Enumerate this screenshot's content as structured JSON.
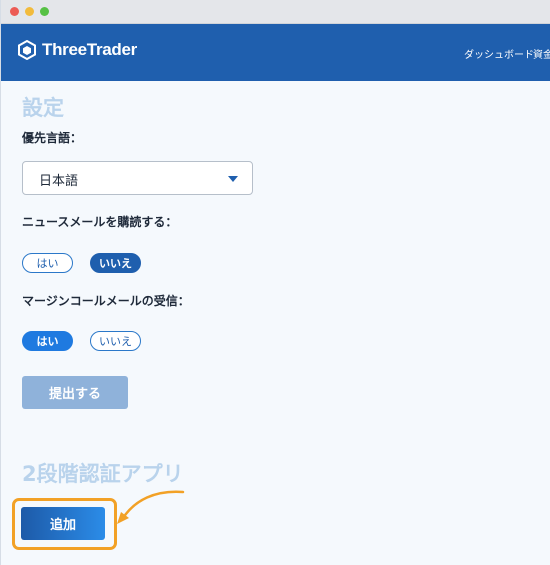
{
  "header": {
    "brand": "ThreeTrader",
    "nav": [
      "ダッシュボード",
      "資金"
    ],
    "colors": {
      "bar": "#1f5fae"
    }
  },
  "settings": {
    "title": "設定",
    "language": {
      "label": "優先言語：",
      "selected": "日本語",
      "icon": "caret-down-icon"
    },
    "newsletter": {
      "label": "ニュースメールを購読する：",
      "yes": "はい",
      "no": "いいえ",
      "selected": "いいえ"
    },
    "margin_call": {
      "label": "マージンコールメールの受信：",
      "yes": "はい",
      "no": "いいえ",
      "selected": "はい"
    },
    "submit_label": "提出する"
  },
  "two_factor": {
    "title": "2段階認証アプリ",
    "add_label": "追加",
    "highlight_color": "#f2a126"
  }
}
